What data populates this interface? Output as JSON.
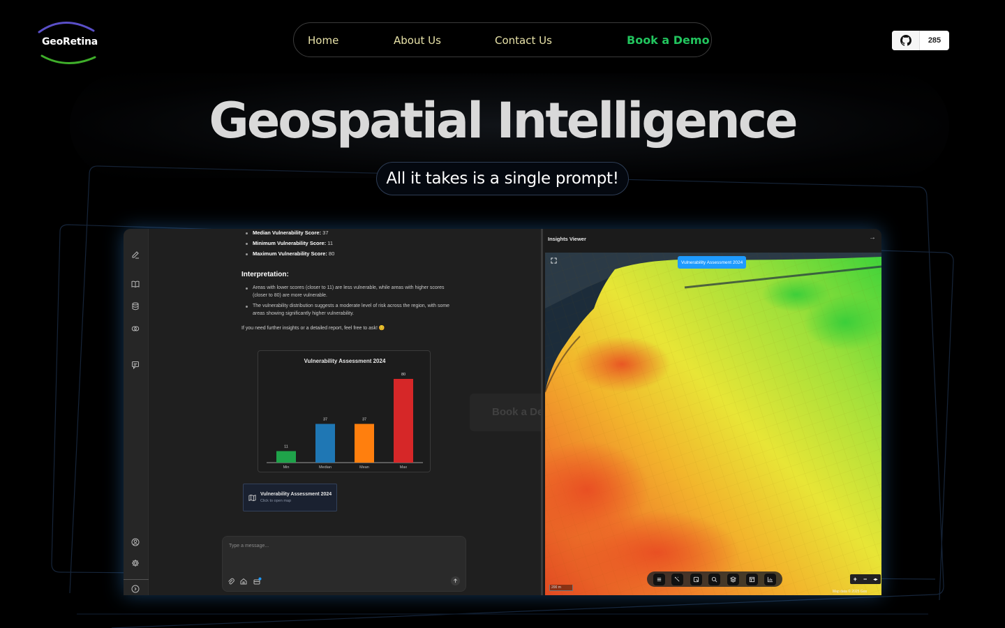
{
  "brand": {
    "name": "GeoRetina"
  },
  "nav": {
    "items": [
      {
        "label": "Home"
      },
      {
        "label": "About Us"
      },
      {
        "label": "Contact Us"
      }
    ],
    "cta": "Book a Demo"
  },
  "github": {
    "stars": "285",
    "icon": "github-icon"
  },
  "hero": {
    "title": "Geospatial Intelligence",
    "subtitle": "All it takes is a single prompt!"
  },
  "app": {
    "chat": {
      "stats": [
        {
          "label": "Median Vulnerability Score:",
          "value": " 37"
        },
        {
          "label": "Minimum Vulnerability Score:",
          "value": " 11"
        },
        {
          "label": "Maximum Vulnerability Score:",
          "value": " 80"
        }
      ],
      "interpretation_heading": "Interpretation:",
      "points": [
        "Areas with lower scores (closer to 11) are less vulnerable, while areas with higher scores (closer to 80) are more vulnerable.",
        "The vulnerability distribution suggests a moderate level of risk across the region, with some areas showing significantly higher vulnerability."
      ],
      "closing": "If you need further insights or a detailed report, feel free to ask! 😊",
      "map_card": {
        "title": "Vulnerability Assessment 2024",
        "subtitle": "Click to open map"
      },
      "message_placeholder": "Type a message..."
    },
    "ghost_cta": "Book a Demo",
    "viewer": {
      "title": "Insights Viewer",
      "badge": "Vulnerability Assessment 2024",
      "scale": "200 m",
      "attribution": "Map data © 2025 Goo"
    }
  },
  "chart_data": {
    "type": "bar",
    "title": "Vulnerability Assessment 2024",
    "categories": [
      "Min",
      "Median",
      "Mean",
      "Max"
    ],
    "values": [
      11,
      37,
      37,
      80
    ],
    "colors": [
      "#1fa34a",
      "#1f77b4",
      "#ff7f0e",
      "#d62728"
    ],
    "ylim": [
      0,
      80
    ],
    "xlabel": "",
    "ylabel": "",
    "grid": false
  },
  "colors": {
    "accent_green": "#22c55e",
    "nav_text": "#e8e2a8",
    "badge_blue": "#1e9bff"
  }
}
